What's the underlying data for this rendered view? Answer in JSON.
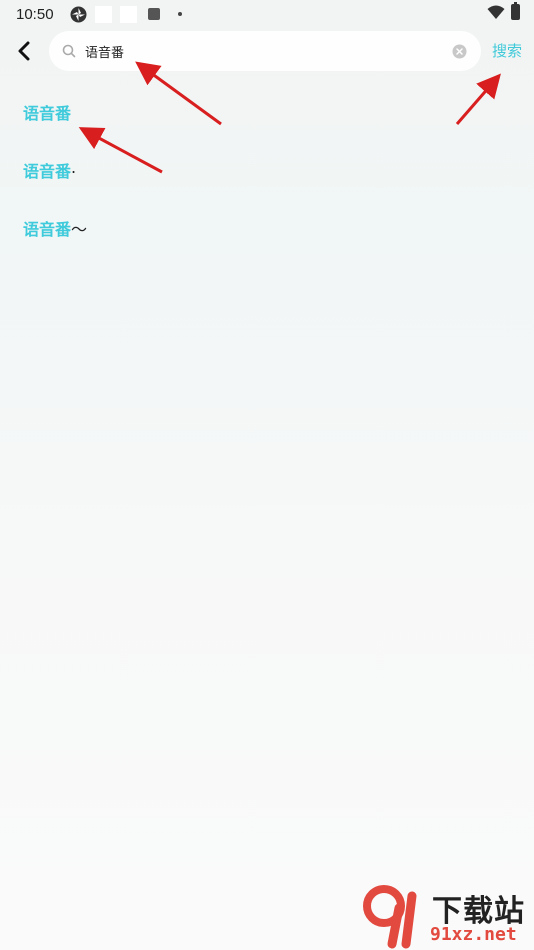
{
  "status_bar": {
    "time": "10:50"
  },
  "header": {
    "back_icon": "chevron-left-icon",
    "search": {
      "value": "语音番",
      "placeholder": "",
      "icon": "search-icon",
      "clear_icon": "clear-icon"
    },
    "search_button_label": "搜索"
  },
  "suggestions": [
    {
      "highlight": "语音番",
      "rest": ""
    },
    {
      "highlight": "语音番",
      "rest": "."
    },
    {
      "highlight": "语音番",
      "rest": "～"
    }
  ],
  "colors": {
    "accent": "#3fcbdb",
    "annotation_arrow": "#d81e1e"
  },
  "watermark": {
    "logo": "91-logo",
    "title": "下载站",
    "url": "91xz.net"
  }
}
